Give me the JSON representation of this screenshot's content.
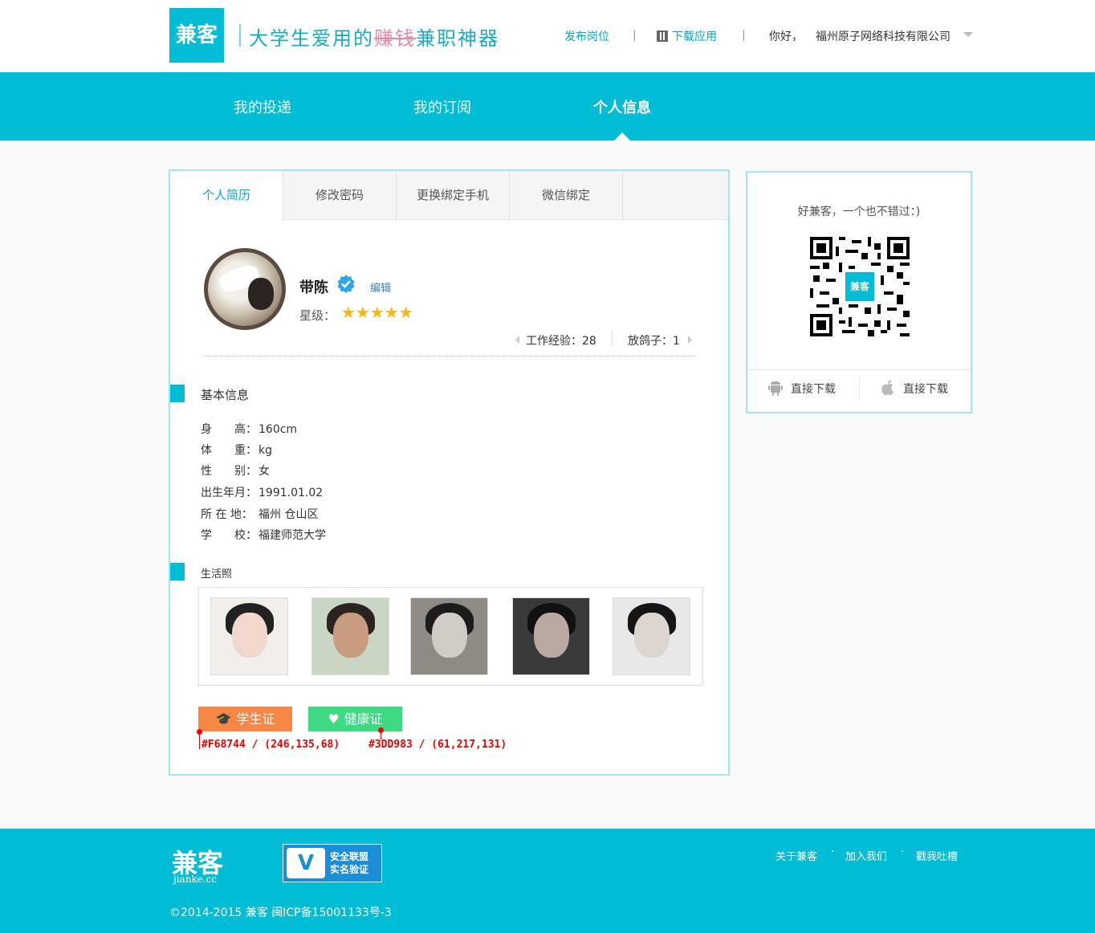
{
  "header": {
    "logo": "兼客",
    "slogan_prefix": "大学生爱用的",
    "slogan_strike": "赚钱",
    "slogan_suffix": "兼职神器",
    "post_job": "发布岗位",
    "download_app": "下载应用",
    "greeting": "你好，",
    "company": "福州原子网络科技有限公司",
    "separator": "|"
  },
  "nav": {
    "tabs": [
      "我的投递",
      "我的订阅",
      "个人信息"
    ],
    "active_index": 2
  },
  "profile": {
    "subtabs": [
      "个人简历",
      "修改密码",
      "更换绑定手机",
      "微信绑定"
    ],
    "active_subtab": 0,
    "name": "带陈",
    "verified_icon": "verified-badge-icon",
    "edit": "编辑",
    "star_label": "星级：",
    "stars": "★★★★★",
    "star_rating": 5,
    "work_exp": "工作经验：28",
    "no_show": "放鸽子：1",
    "basic_title": "基本信息",
    "basic_info": [
      {
        "label": "身　　高：",
        "value": "160cm"
      },
      {
        "label": "体　　重：",
        "value": "kg"
      },
      {
        "label": "性　　别：",
        "value": "女"
      },
      {
        "label": "出生年月：",
        "value": "1991.01.02"
      },
      {
        "label": "所 在 地：",
        "value": "福州 仓山区"
      },
      {
        "label": "学　　校：",
        "value": "福建师范大学"
      }
    ],
    "photos_title": "生活照",
    "badge_student": "学生证",
    "badge_health": "健康证",
    "anno_student": "#F68744 / (246,135,68)",
    "anno_health": "#3DD983 / (61,217,131)",
    "colors": {
      "student": "#F68744",
      "health": "#3DD983",
      "accent": "#00BCD4"
    }
  },
  "side": {
    "tagline": "好兼客，一个也不错过：)",
    "qr_center": "兼客",
    "android_download": "直接下载",
    "ios_download": "直接下载"
  },
  "footer": {
    "logo": "兼客",
    "domain": "jianke.cc",
    "badge_line1": "安全联盟",
    "badge_line2": "实名验证",
    "badge_v": "V",
    "links": [
      "关于兼客",
      "加入我们",
      "戳我吐槽"
    ],
    "dot": "·",
    "copyright": "©2014-2015 兼客 闽ICP备15001133号-3"
  }
}
